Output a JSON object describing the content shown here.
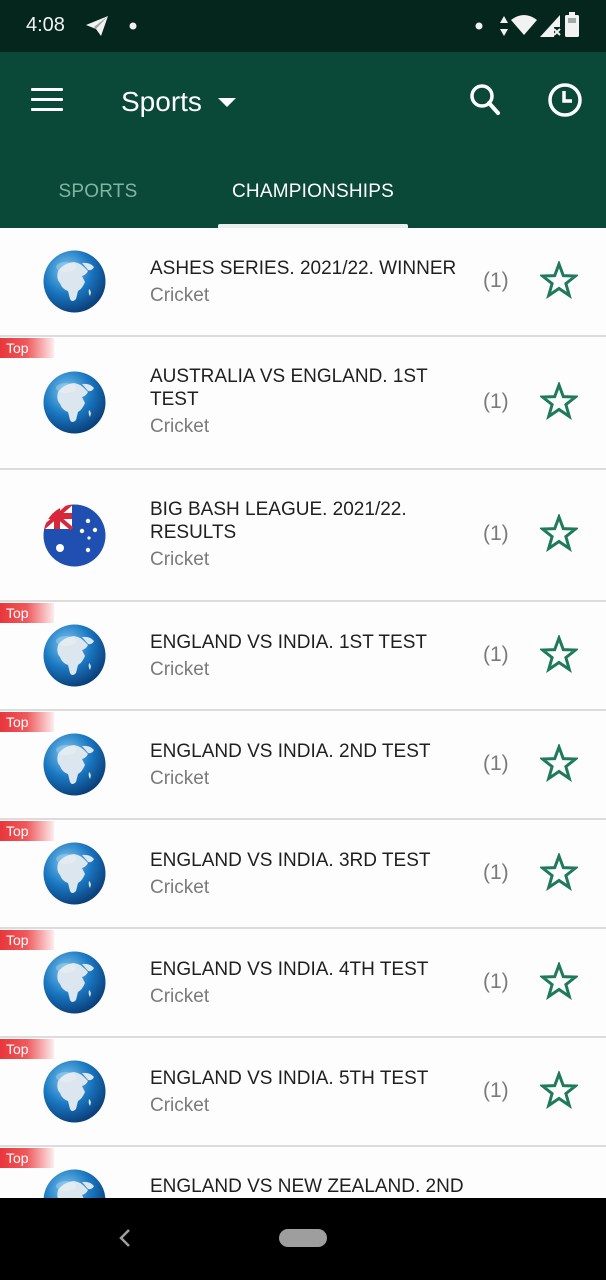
{
  "status_bar": {
    "time": "4:08",
    "left_icons": [
      "telegram-icon",
      "notification-dot-icon"
    ],
    "right_icons": [
      "notification-dot-icon",
      "data-arrows-icon",
      "wifi-icon",
      "cellular-no-signal-icon",
      "battery-icon"
    ]
  },
  "app_bar": {
    "menu_icon": "hamburger-menu-icon",
    "title": "Sports",
    "title_dropdown_icon": "caret-down-icon",
    "actions": [
      "search-icon",
      "history-clock-icon"
    ]
  },
  "tabs": [
    {
      "label": "SPORTS",
      "active": false
    },
    {
      "label": "CHAMPIONSHIPS",
      "active": true
    }
  ],
  "badge_label": "Top",
  "colors": {
    "status_bar_bg": "#05261c",
    "app_bar_bg": "#0a4838",
    "inactive_tab": "#7fb5a2",
    "star_outline": "#1e7a5a",
    "top_badge": "#e8363b",
    "title_text": "#1f1f1f",
    "subtitle_text": "#7a7a7a"
  },
  "championships": [
    {
      "title": "ASHES SERIES. 2021/22. WINNER",
      "sport": "Cricket",
      "count": "(1)",
      "top": false,
      "logo": "globe-icon",
      "favorite": false
    },
    {
      "title": "AUSTRALIA VS ENGLAND. 1ST TEST",
      "sport": "Cricket",
      "count": "(1)",
      "top": true,
      "logo": "globe-icon",
      "favorite": false
    },
    {
      "title": "BIG BASH LEAGUE. 2021/22. RESULTS",
      "sport": "Cricket",
      "count": "(1)",
      "top": false,
      "logo": "australia-flag-icon",
      "favorite": false
    },
    {
      "title": "ENGLAND VS INDIA. 1ST TEST",
      "sport": "Cricket",
      "count": "(1)",
      "top": true,
      "logo": "globe-icon",
      "favorite": false
    },
    {
      "title": "ENGLAND VS INDIA. 2ND TEST",
      "sport": "Cricket",
      "count": "(1)",
      "top": true,
      "logo": "globe-icon",
      "favorite": false
    },
    {
      "title": "ENGLAND VS INDIA. 3RD TEST",
      "sport": "Cricket",
      "count": "(1)",
      "top": true,
      "logo": "globe-icon",
      "favorite": false
    },
    {
      "title": "ENGLAND VS INDIA. 4TH TEST",
      "sport": "Cricket",
      "count": "(1)",
      "top": true,
      "logo": "globe-icon",
      "favorite": false
    },
    {
      "title": "ENGLAND VS INDIA. 5TH TEST",
      "sport": "Cricket",
      "count": "(1)",
      "top": true,
      "logo": "globe-icon",
      "favorite": false
    },
    {
      "title": "ENGLAND VS NEW ZEALAND. 2ND",
      "sport": "",
      "count": "",
      "top": true,
      "logo": "globe-icon",
      "favorite": false
    }
  ],
  "nav_bar": {
    "back_icon": "back-chevron-icon",
    "home_icon": "home-pill-icon"
  }
}
